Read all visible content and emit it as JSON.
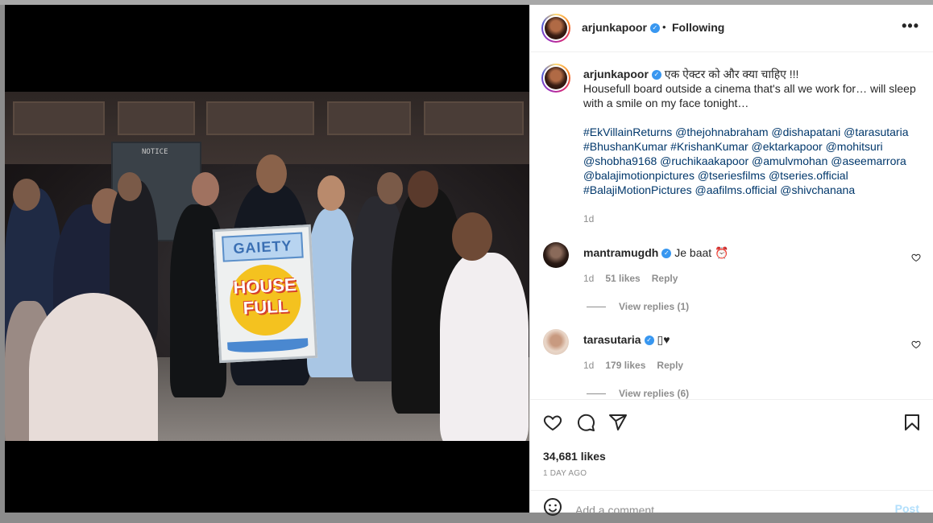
{
  "post": {
    "author": "arjunkapoor",
    "follow_status": "Following",
    "separator": "•",
    "more_icon": "more-dots-icon"
  },
  "caption": {
    "author": "arjunkapoor",
    "hindi": "एक ऐक्टर को और क्या चाहिए !!!",
    "text": "Housefull board outside a cinema that's all we work for… will sleep with a smile on my face tonight…",
    "tags": "#EkVillainReturns @thejohnabraham @dishapatani @tarasutaria #BhushanKumar #KrishanKumar @ektarkapoor @mohitsuri @shobha9168 @ruchikaakapoor @amulvmohan @aseemarrora @balajimotionpictures @tseriesfilms @tseries.official #BalajiMotionPictures @aafilms.official @shivchanana",
    "time": "1d"
  },
  "comments": [
    {
      "user": "mantramugdh",
      "text": "Je baat ⏰",
      "time": "1d",
      "likes": "51 likes",
      "reply": "Reply",
      "view_replies": "View replies (1)"
    },
    {
      "user": "tarasutaria",
      "text": "▯♥",
      "time": "1d",
      "likes": "179 likes",
      "reply": "Reply",
      "view_replies": "View replies (6)"
    }
  ],
  "stats": {
    "likes": "34,681 likes",
    "posted": "1 DAY AGO"
  },
  "add_comment": {
    "placeholder": "Add a comment...",
    "post_label": "Post"
  },
  "photo": {
    "notice_sign": "NOTICE",
    "board_top": "GAIETY",
    "board_line1": "HOUSE",
    "board_line2": "FULL"
  },
  "colors": {
    "verified": "#3897f0",
    "link": "#00376b",
    "muted": "#8e8e8e",
    "post_disabled": "#b2dffc"
  }
}
